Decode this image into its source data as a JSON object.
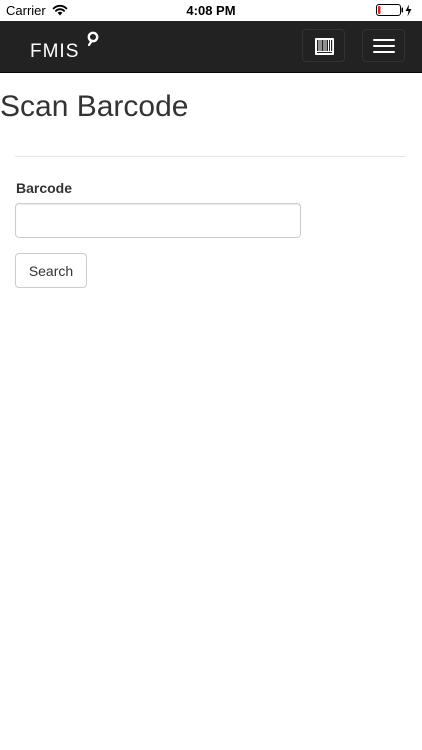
{
  "status_bar": {
    "carrier": "Carrier",
    "time": "4:08 PM",
    "wifi_icon": "wifi-icon",
    "battery_icon": "battery-low-charging-icon",
    "battery_color": "#e02020"
  },
  "navbar": {
    "logo_text": "FMIS",
    "background": "#222222",
    "barcode_button_icon": "barcode-icon",
    "menu_button_icon": "hamburger-menu-icon"
  },
  "page": {
    "title": "Scan Barcode",
    "barcode_label": "Barcode",
    "barcode_value": "",
    "barcode_placeholder": "",
    "search_button_label": "Search"
  }
}
